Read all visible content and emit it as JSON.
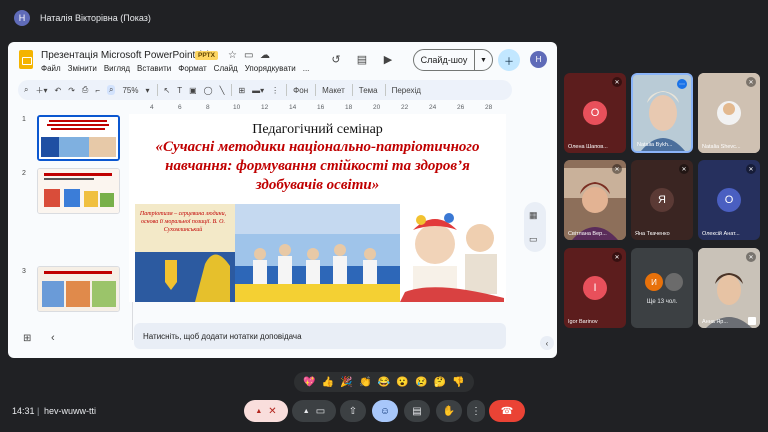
{
  "presenter": {
    "avatar_letter": "Н",
    "name": "Наталія Вікторівна (Показ)"
  },
  "slides_app": {
    "title": "Презентація Microsoft PowerPoint (1)",
    "badge": "PPTX",
    "menu": [
      "Файл",
      "Змінити",
      "Вигляд",
      "Вставити",
      "Формат",
      "Слайд",
      "Упорядкувати",
      "..."
    ],
    "slideshow_label": "Слайд-шоу",
    "user_avatar_letter": "Н",
    "toolbar": {
      "zoom": "75%",
      "background": "Фон",
      "layout": "Макет",
      "theme": "Тема",
      "transition": "Перехід"
    },
    "ruler_ticks": [
      "4",
      "6",
      "8",
      "10",
      "12",
      "14",
      "16",
      "18",
      "20",
      "22",
      "24",
      "26",
      "28"
    ],
    "thumbnails": [
      {
        "num": "1"
      },
      {
        "num": "2"
      },
      {
        "num": "3"
      }
    ],
    "slide": {
      "heading": "Педагогічний семінар",
      "title": "«Сучасні методики національно-патріотичного навчання: формування стійкості та здоров’я здобувачів освіти»",
      "quote": "Патріотизм – серцевина людини, основа її моральної позиції. В. О. Сухомлинський"
    },
    "notes_placeholder": "Натисніть, щоб додати нотатки доповідача"
  },
  "participants": [
    {
      "name": "Олена Шапов...",
      "letter": "О",
      "color": "#e8505b",
      "bg": "#5c1d1d"
    },
    {
      "name": "Natalia Bykh...",
      "letter": "",
      "color": "",
      "bg": "#b9cbd6"
    },
    {
      "name": "Natalia Shevc...",
      "letter": "",
      "color": "",
      "bg": "#cfc1b2"
    },
    {
      "name": "Світлана Вер...",
      "letter": "",
      "color": "",
      "bg": "#8d6f5a"
    },
    {
      "name": "Яна Ткаченко",
      "letter": "Я",
      "color": "#5b3a35",
      "bg": "#3a2522"
    },
    {
      "name": "Олексій Анат...",
      "letter": "О",
      "color": "#4a5fc1",
      "bg": "#26305e"
    },
    {
      "name": "Igor Barinov",
      "letter": "I",
      "color": "#e8505b",
      "bg": "#5c1d1d"
    },
    {
      "name": "Ще 13 чол.",
      "letter": "И",
      "color": "#e8710a",
      "bg": "#3c4043"
    },
    {
      "name": "Анна Яр...",
      "letter": "",
      "color": "",
      "bg": "#c9c2b8"
    }
  ],
  "reactions": [
    "💖",
    "👍",
    "🎉",
    "👏",
    "😂",
    "😮",
    "😢",
    "🤔",
    "👎"
  ],
  "footer": {
    "time": "14:31",
    "divider": "|",
    "meeting_code": "hev-wuww-tti"
  },
  "colors": {
    "accent": "#0b57d0",
    "hangup": "#ea4335",
    "slide_title_red": "#c00000"
  }
}
